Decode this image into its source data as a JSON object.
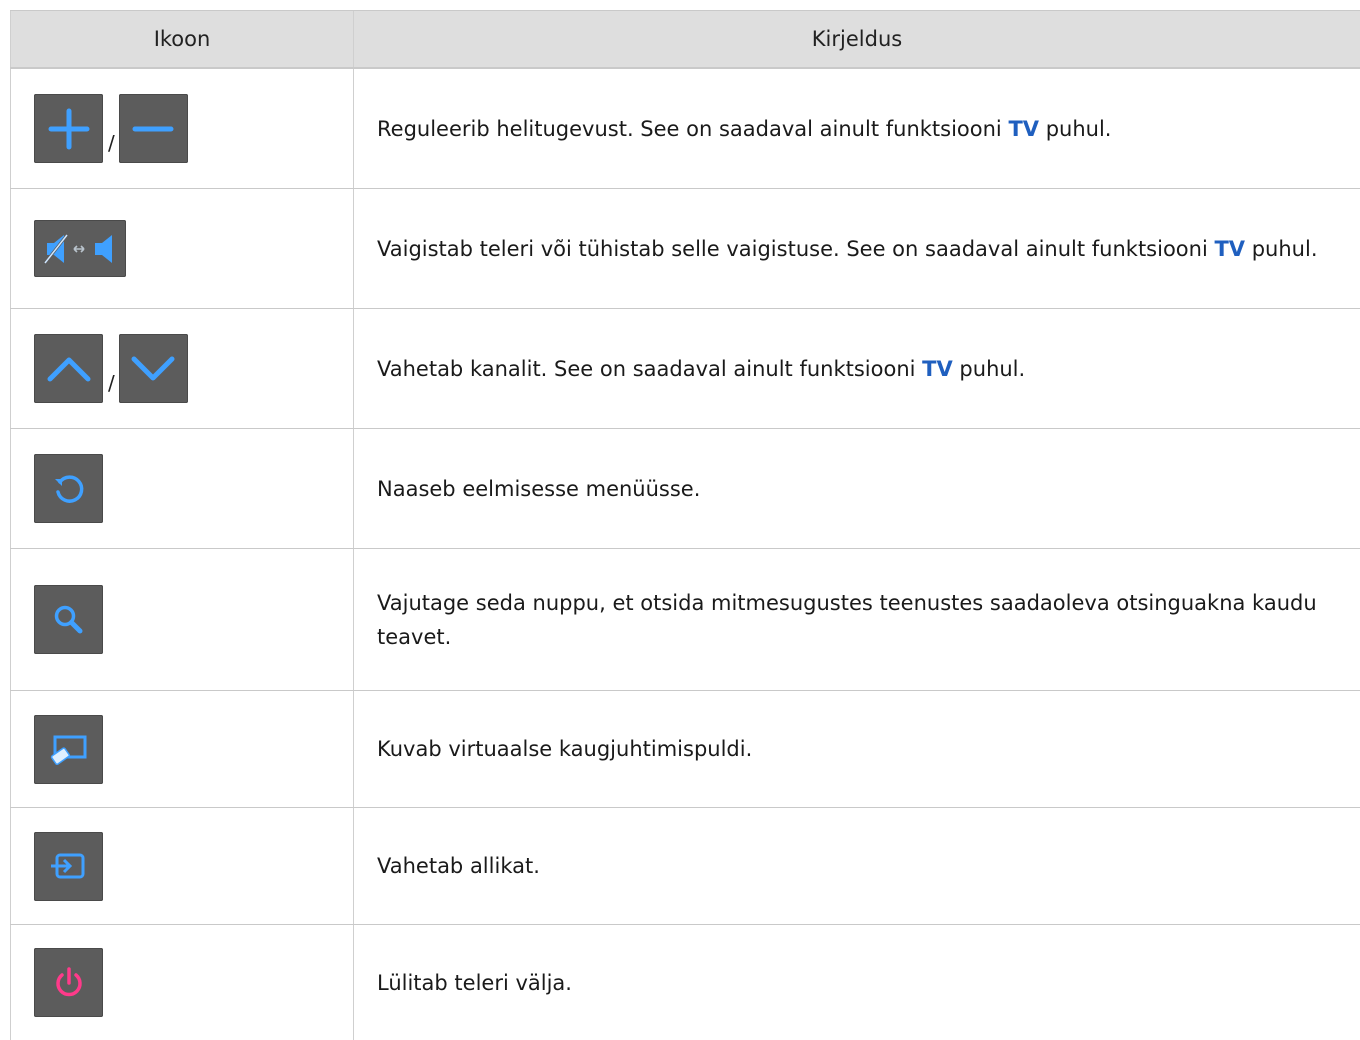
{
  "header": {
    "col_icon": "Ikoon",
    "col_desc": "Kirjeldus"
  },
  "separator": "/",
  "highlight_color": "#1f5fbf",
  "rows": [
    {
      "icons": [
        "volume-up-icon",
        "volume-down-icon"
      ],
      "desc_before": "Reguleerib helitugevust. See on saadaval ainult funktsiooni ",
      "highlight": "TV",
      "desc_after": " puhul."
    },
    {
      "icons": [
        "mute-toggle-icon"
      ],
      "desc_before": "Vaigistab teleri või tühistab selle vaigistuse. See on saadaval ainult funktsiooni ",
      "highlight": "TV",
      "desc_after": " puhul."
    },
    {
      "icons": [
        "channel-up-icon",
        "channel-down-icon"
      ],
      "desc_before": "Vahetab kanalit. See on saadaval ainult funktsiooni ",
      "highlight": "TV",
      "desc_after": " puhul."
    },
    {
      "icons": [
        "return-icon"
      ],
      "desc": "Naaseb eelmisesse menüüsse."
    },
    {
      "icons": [
        "search-icon"
      ],
      "desc": "Vajutage seda nuppu, et otsida mitmesugustes teenustes saadaoleva otsinguakna kaudu teavet."
    },
    {
      "icons": [
        "virtual-remote-icon"
      ],
      "desc": "Kuvab virtuaalse kaugjuhtimispuldi."
    },
    {
      "icons": [
        "source-icon"
      ],
      "desc": "Vahetab allikat."
    },
    {
      "icons": [
        "power-icon"
      ],
      "desc": "Lülitab teleri välja."
    }
  ]
}
